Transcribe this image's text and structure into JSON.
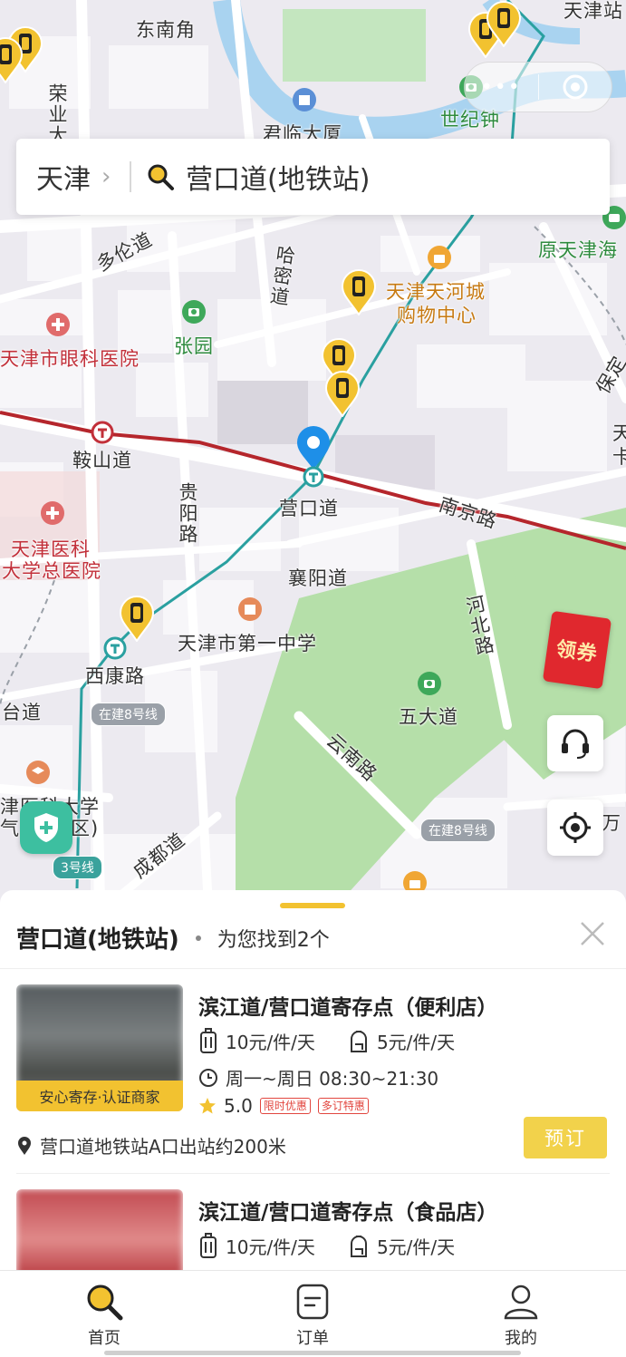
{
  "search": {
    "city": "天津",
    "query": "营口道(地铁站)"
  },
  "map": {
    "labels": {
      "dongnanjiao": "东南角",
      "tianjinzhan": "天津站",
      "junlin": "君临大厦",
      "shijizhong": "世纪钟",
      "rongye": "荣业大",
      "duolun": "多伦道",
      "hami": "哈密道",
      "tianhe": "天津天河城",
      "tianhe2": "购物中心",
      "yuan_tianjin": "原天津海",
      "zhangyuan": "张园",
      "eye_hospital": "天津市眼科医院",
      "baoding": "保定",
      "anshan": "鞍山道",
      "yingkou": "营口道",
      "nanjing": "南京路",
      "guiyang": "贵阳路",
      "general_hosp1": "天津医科",
      "general_hosp2": "大学总医院",
      "xiangyang": "襄阳道",
      "first_middle": "天津市第一中学",
      "hebei": "河北路",
      "xikang": "西康路",
      "wudadao": "五大道",
      "taidao": "台道",
      "yunnan": "云南路",
      "medical_univ1": "津医科大学",
      "medical_univ2": "气象",
      "medical_univ3": "区)",
      "chengdu": "成都道",
      "wan": "万",
      "tian_k1": "天",
      "tian_k2": "卡"
    },
    "line_tags": {
      "line8_a": "在建8号线",
      "line8_b": "在建8号线",
      "line3": "3号线"
    },
    "coupon_label": "领券"
  },
  "sheet": {
    "title": "营口道(地铁站)",
    "count_text": "为您找到2个"
  },
  "results": [
    {
      "title": "滨江道/营口道寄存点（便利店）",
      "price_luggage": "10元/件/天",
      "price_bag": "5元/件/天",
      "hours": "周一~周日 08:30~21:30",
      "rating": "5.0",
      "tags": [
        "限时优惠",
        "多订特惠"
      ],
      "badge": "安心寄存·认证商家",
      "location": "营口道地铁站A口出站约200米",
      "book_label": "预订"
    },
    {
      "title": "滨江道/营口道寄存点（食品店）",
      "price_luggage": "10元/件/天",
      "price_bag": "5元/件/天"
    }
  ],
  "tabs": [
    {
      "label": "首页",
      "icon": "search-icon"
    },
    {
      "label": "订单",
      "icon": "order-icon"
    },
    {
      "label": "我的",
      "icon": "profile-icon"
    }
  ],
  "colors": {
    "accent": "#f2c230",
    "metro_red": "#b5262c",
    "metro_teal": "#2aa0a0",
    "park_green": "#a8dca0",
    "river": "#a9d3f0"
  }
}
